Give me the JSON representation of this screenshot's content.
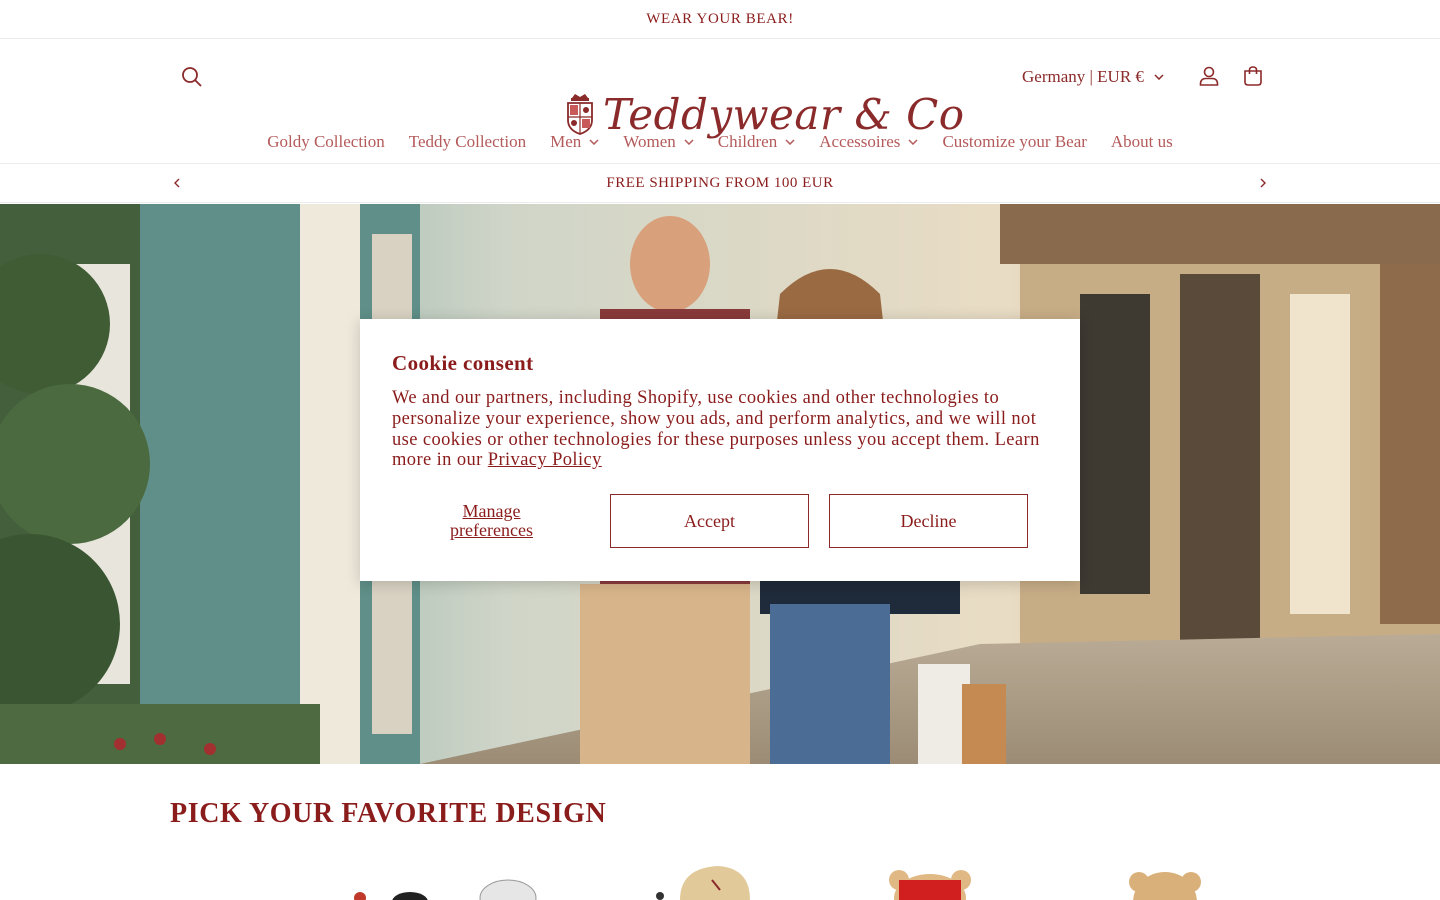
{
  "announcement": "WEAR YOUR BEAR!",
  "header": {
    "logo_text": "Teddywear & Co",
    "locale": "Germany | EUR €"
  },
  "nav": [
    {
      "label": "Goldy Collection",
      "dropdown": false
    },
    {
      "label": "Teddy Collection",
      "dropdown": false
    },
    {
      "label": "Men",
      "dropdown": true
    },
    {
      "label": "Women",
      "dropdown": true
    },
    {
      "label": "Children",
      "dropdown": true
    },
    {
      "label": "Accessoires",
      "dropdown": true
    },
    {
      "label": "Customize your Bear",
      "dropdown": false
    },
    {
      "label": "About us",
      "dropdown": false
    }
  ],
  "promo": "FREE SHIPPING FROM 100 EUR",
  "cookie": {
    "title": "Cookie consent",
    "body": "We and our partners, including Shopify, use cookies and other technologies to personalize your experience, show you ads, and perform analytics, and we will not use cookies or other technologies for these purposes unless you accept them. Learn more in our",
    "privacy_link": "Privacy Policy",
    "manage_line1": "Manage",
    "manage_line2": "preferences",
    "accept": "Accept",
    "decline": "Decline"
  },
  "section_title": "PICK YOUR FAVORITE DESIGN",
  "colors": {
    "brand": "#8b1c1c",
    "nav_text": "#b45a5a",
    "border": "#ececec"
  },
  "icons": [
    "search-icon",
    "account-icon",
    "cart-icon",
    "chevron-down-icon",
    "chevron-left-icon",
    "chevron-right-icon"
  ]
}
